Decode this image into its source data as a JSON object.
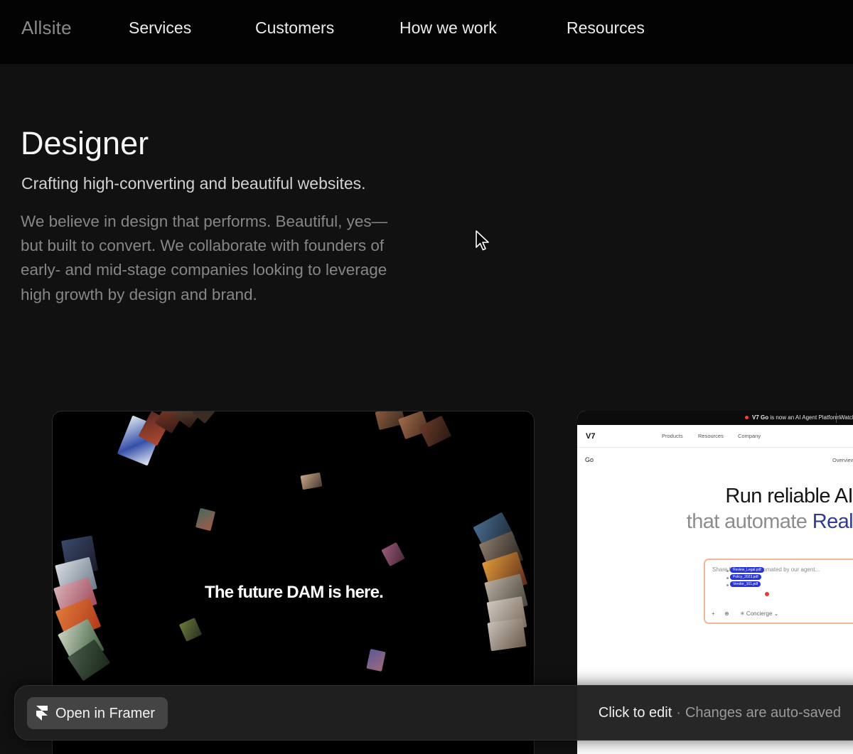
{
  "nav": {
    "logo": "Allsite",
    "links": [
      "Services",
      "Customers",
      "How we work",
      "Resources"
    ]
  },
  "hero": {
    "title": "Designer",
    "subtitle": "Crafting high-converting and beautiful websites.",
    "body": "We believe in design that performs. Beautiful, yes—but built to convert. We collaborate with founders of early- and mid-stage companies looking to leverage high growth by design and brand."
  },
  "showcase": {
    "card1": {
      "heading": "The future DAM is here."
    },
    "card2": {
      "banner_brand": "V7 Go",
      "banner_text": " is now an AI Agent Platform",
      "banner_action": "Watch",
      "logo": "V7",
      "nav": [
        "Products",
        "Resources",
        "Company"
      ],
      "product": "Go",
      "overview": "Overview",
      "headline_1": "Run reliable AI",
      "headline_2_prefix": "that automate ",
      "headline_2_accent": "Real",
      "prompt_placeholder": "Share files to be automated by our agent...",
      "chips": [
        "Review_Legal.pdf",
        "Policy_2023.pdf",
        "Vendor_101.pdf"
      ],
      "tool_plus": "+",
      "tool_globe": "⊕",
      "tool_agent": "✳ Concierge ⌄",
      "accent_color": "#2f3b91"
    }
  },
  "bottom_bar": {
    "open_label": "Open in Framer",
    "click_edit": "Click to edit",
    "separator": "·",
    "autosave": "Changes are auto-saved"
  },
  "icons": [
    "framer-icon",
    "mouse-cursor-icon"
  ]
}
